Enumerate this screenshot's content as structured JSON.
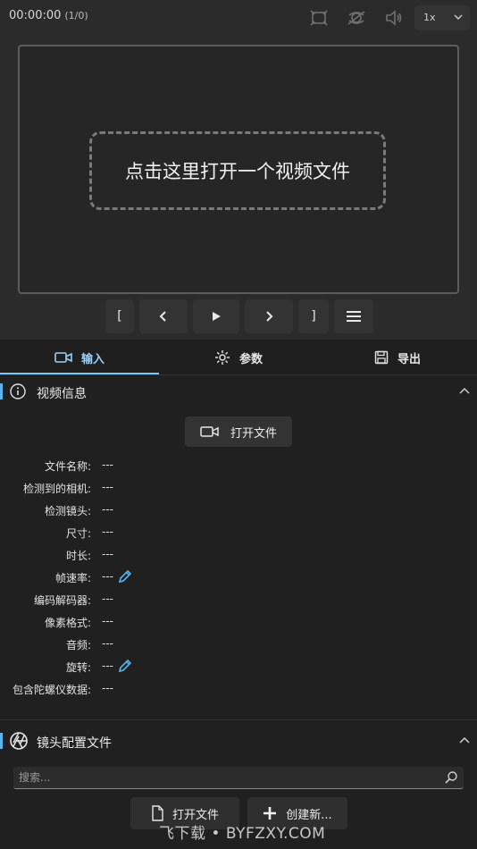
{
  "topbar": {
    "time": "00:00:00",
    "frames": "(1/0)",
    "icons": [
      "fullscreen-icon",
      "stabilize-icon",
      "volume-icon"
    ],
    "speed": "1x"
  },
  "player": {
    "drop_text": "点击这里打开一个视频文件",
    "controls": {
      "mark_in": "[",
      "mark_out": "]"
    }
  },
  "tabs": [
    {
      "label": "输入",
      "icon": "camera-icon",
      "active": true
    },
    {
      "label": "参数",
      "icon": "gear-icon",
      "active": false
    },
    {
      "label": "导出",
      "icon": "save-icon",
      "active": false
    }
  ],
  "video_info": {
    "title": "视频信息",
    "open_file_label": "打开文件",
    "properties": [
      {
        "label": "文件名称:",
        "value": "---"
      },
      {
        "label": "检测到的相机:",
        "value": "---"
      },
      {
        "label": "检测镜头:",
        "value": "---"
      },
      {
        "label": "尺寸:",
        "value": "---"
      },
      {
        "label": "时长:",
        "value": "---"
      },
      {
        "label": "帧速率:",
        "value": "---"
      },
      {
        "label": "编码解码器:",
        "value": "---"
      },
      {
        "label": "像素格式:",
        "value": "---"
      },
      {
        "label": "音频:",
        "value": "---"
      },
      {
        "label": "旋转:",
        "value": "---"
      },
      {
        "label": "包含陀螺仪数据:",
        "value": "---"
      }
    ]
  },
  "lens_profile": {
    "title": "镜头配置文件",
    "search_placeholder": "搜索...",
    "open_file_label": "打开文件",
    "create_new_label": "创建新..."
  },
  "watermark": "飞下载 • BYFZXY.COM",
  "colors": {
    "accent": "#5ab4ee",
    "background": "#202020",
    "panel": "#2b2b2b"
  }
}
